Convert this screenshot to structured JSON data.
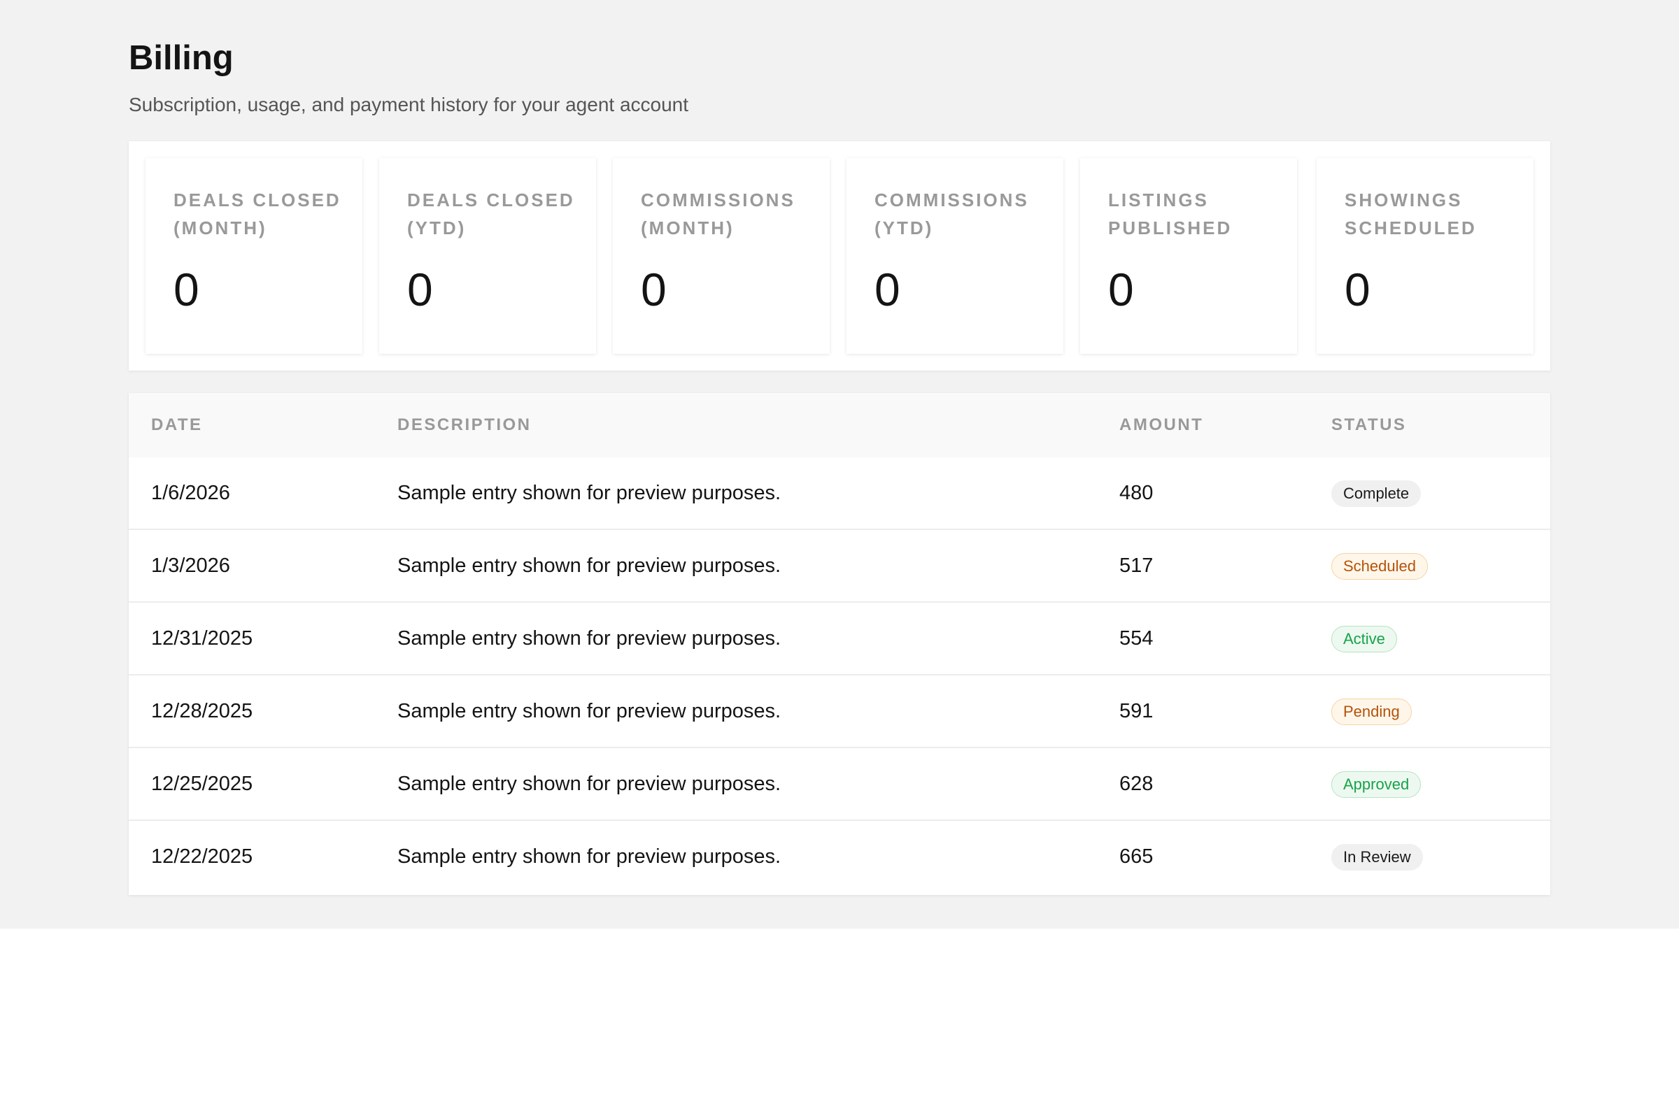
{
  "header": {
    "title": "Billing",
    "subtitle": "Subscription, usage, and payment history for your agent account"
  },
  "stats": [
    {
      "label": "Deals Closed (Month)",
      "value": "0"
    },
    {
      "label": "Deals Closed (YTD)",
      "value": "0"
    },
    {
      "label": "Commissions (Month)",
      "value": "0"
    },
    {
      "label": "Commissions (YTD)",
      "value": "0"
    },
    {
      "label": "Listings Published",
      "value": "0"
    },
    {
      "label": "Showings Scheduled",
      "value": "0"
    }
  ],
  "table": {
    "columns": [
      "Date",
      "Description",
      "Amount",
      "Status"
    ],
    "rows": [
      {
        "date": "1/6/2026",
        "description": "Sample entry shown for preview purposes.",
        "amount": "480",
        "status": "Complete"
      },
      {
        "date": "1/3/2026",
        "description": "Sample entry shown for preview purposes.",
        "amount": "517",
        "status": "Scheduled"
      },
      {
        "date": "12/31/2025",
        "description": "Sample entry shown for preview purposes.",
        "amount": "554",
        "status": "Active"
      },
      {
        "date": "12/28/2025",
        "description": "Sample entry shown for preview purposes.",
        "amount": "591",
        "status": "Pending"
      },
      {
        "date": "12/25/2025",
        "description": "Sample entry shown for preview purposes.",
        "amount": "628",
        "status": "Approved"
      },
      {
        "date": "12/22/2025",
        "description": "Sample entry shown for preview purposes.",
        "amount": "665",
        "status": "In Review"
      }
    ]
  },
  "colors": {
    "page_background": "#f2f2f2",
    "badge_neutral": "#f0f0f0",
    "badge_warning_text": "#b45309",
    "badge_success_text": "#16a34a"
  }
}
